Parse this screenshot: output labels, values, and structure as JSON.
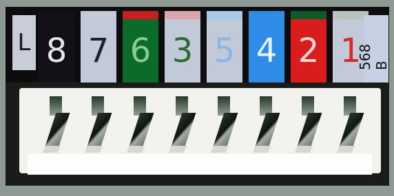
{
  "left_tab_text": "L",
  "side_label": "568 B",
  "positions": [
    {
      "label": "8",
      "bg": "#141017",
      "text": "#e6e6e6",
      "strip": "#141017"
    },
    {
      "label": "7",
      "bg": "#c2c9d8",
      "text": "#202228",
      "strip": "#c5cad6"
    },
    {
      "label": "6",
      "bg": "#0b6b2a",
      "text": "#8acb93",
      "strip": "#c51f1f"
    },
    {
      "label": "3",
      "bg": "#c2c9d8",
      "text": "#2c6a33",
      "strip": "#d9a6ad"
    },
    {
      "label": "5",
      "bg": "#c2c9d8",
      "text": "#8ab6e8",
      "strip": "#a9c8ea"
    },
    {
      "label": "4",
      "bg": "#2e8be6",
      "text": "#e7f2ff",
      "strip": "#2e8be6"
    },
    {
      "label": "2",
      "bg": "#d91c1c",
      "text": "#f6d5d5",
      "strip": "#0e5a2a"
    },
    {
      "label": "1",
      "bg": "#c2c9d8",
      "text": "#d52a2a",
      "strip": "#b9c3bd"
    }
  ]
}
